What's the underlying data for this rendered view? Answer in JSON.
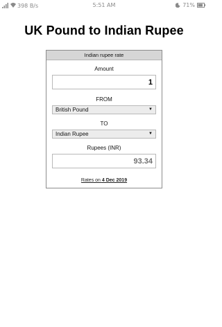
{
  "status_bar": {
    "network_speed": "398 B/s",
    "time": "5:51 AM",
    "battery_percent": "71%"
  },
  "page": {
    "title": "UK Pound to Indian Rupee"
  },
  "converter": {
    "header": "Indian rupee rate",
    "amount_label": "Amount",
    "amount_value": "1",
    "from_label": "FROM",
    "from_selected": "British Pound",
    "to_label": "TO",
    "to_selected": "Indian Rupee",
    "result_label": "Rupees (INR)",
    "result_value": "93.34",
    "rates_prefix": "Rates on",
    "rates_date": "4 Dec 2019"
  },
  "icons": {
    "signal": "signal-icon",
    "wifi": "wifi-icon",
    "moon": "moon-icon",
    "battery": "battery-icon",
    "dropdown": "chevron-down-icon"
  },
  "colors": {
    "header_bg": "#d6d6d6",
    "border": "#8c8c8c",
    "result_text": "#707070"
  }
}
